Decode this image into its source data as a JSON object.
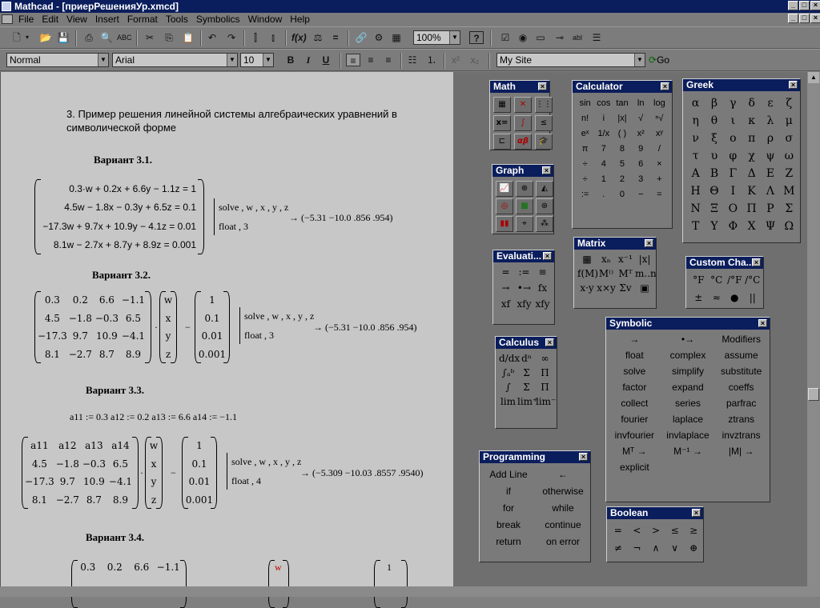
{
  "window": {
    "title": "Mathcad - [приерРешенияУр.xmcd]"
  },
  "menu": [
    "File",
    "Edit",
    "View",
    "Insert",
    "Format",
    "Tools",
    "Symbolics",
    "Window",
    "Help"
  ],
  "toolbar": {
    "zoom": "100%",
    "style": "Normal",
    "font": "Arial",
    "size": "10",
    "address": "My Site",
    "go": "Go"
  },
  "doc": {
    "heading": "3. Пример решения линейной системы алгебраических уравнений в символической форме",
    "v1": {
      "title": "Вариант 3.1.",
      "eqs": [
        "0.3·w + 0.2x + 6.6y − 1.1z = 1",
        "4.5w − 1.8x − 0.3y + 6.5z = 0.1",
        "−17.3w + 9.7x + 10.9y − 4.1z = 0.01",
        "8.1w − 2.7x + 8.7y + 8.9z = 0.001"
      ],
      "cmd1": "solve , w , x , y , z",
      "cmd2": "float , 3",
      "result": "→ (−5.31   −10.0   .856   .954)"
    },
    "v2": {
      "title": "Вариант 3.2.",
      "A": [
        [
          "0.3",
          "0.2",
          "6.6",
          "−1.1"
        ],
        [
          "4.5",
          "−1.8",
          "−0.3",
          "6.5"
        ],
        [
          "−17.3",
          "9.7",
          "10.9",
          "−4.1"
        ],
        [
          "8.1",
          "−2.7",
          "8.7",
          "8.9"
        ]
      ],
      "vars": [
        "w",
        "x",
        "y",
        "z"
      ],
      "b": [
        "1",
        "0.1",
        "0.01",
        "0.001"
      ],
      "cmd1": "solve , w , x , y , z",
      "cmd2": "float , 3",
      "result": "→ (−5.31   −10.0   .856   .954)"
    },
    "v3": {
      "title": "Вариант 3.3.",
      "defs": "a11 := 0.3    a12 := 0.2    a13 := 6.6    a14 := −1.1",
      "A": [
        [
          "a11",
          "a12",
          "a13",
          "a14"
        ],
        [
          "4.5",
          "−1.8",
          "−0.3",
          "6.5"
        ],
        [
          "−17.3",
          "9.7",
          "10.9",
          "−4.1"
        ],
        [
          "8.1",
          "−2.7",
          "8.7",
          "8.9"
        ]
      ],
      "vars": [
        "w",
        "x",
        "y",
        "z"
      ],
      "b": [
        "1",
        "0.1",
        "0.01",
        "0.001"
      ],
      "cmd1": "solve , w , x , y , z",
      "cmd2": "float , 4",
      "result": "→ (−5.309   −10.03   .8557   .9540)"
    },
    "v4": {
      "title": "Вариант 3.4.",
      "row": [
        "0.3",
        "0.2",
        "6.6",
        "−1.1"
      ],
      "var": "w",
      "b": "1"
    }
  },
  "palettes": {
    "math": {
      "title": "Math",
      "items": [
        "calculator-icon",
        "graph-icon",
        "matrix-icon",
        "evaluation-icon",
        "calculus-icon",
        "boolean-icon",
        "programming-icon",
        "greek-icon",
        "symbolic-icon"
      ]
    },
    "calculator": {
      "title": "Calculator",
      "rows": [
        [
          "sin",
          "cos",
          "tan",
          "ln",
          "log"
        ],
        [
          "n!",
          "i",
          "|x|",
          "√",
          "ⁿ√"
        ],
        [
          "eˣ",
          "1/x",
          "( )",
          "x²",
          "xʸ"
        ],
        [
          "π",
          "7",
          "8",
          "9",
          "/"
        ],
        [
          "÷",
          "4",
          "5",
          "6",
          "×"
        ],
        [
          "÷",
          "1",
          "2",
          "3",
          "+"
        ],
        [
          ":=",
          ".",
          "0",
          "−",
          "="
        ]
      ]
    },
    "greek": {
      "title": "Greek",
      "rows": [
        [
          "α",
          "β",
          "γ",
          "δ",
          "ε",
          "ζ"
        ],
        [
          "η",
          "θ",
          "ι",
          "κ",
          "λ",
          "μ"
        ],
        [
          "ν",
          "ξ",
          "ο",
          "π",
          "ρ",
          "σ"
        ],
        [
          "τ",
          "υ",
          "φ",
          "χ",
          "ψ",
          "ω"
        ],
        [
          "Α",
          "Β",
          "Γ",
          "Δ",
          "Ε",
          "Ζ"
        ],
        [
          "Η",
          "Θ",
          "Ι",
          "Κ",
          "Λ",
          "Μ"
        ],
        [
          "Ν",
          "Ξ",
          "Ο",
          "Π",
          "Ρ",
          "Σ"
        ],
        [
          "Τ",
          "Υ",
          "Φ",
          "Χ",
          "Ψ",
          "Ω"
        ]
      ]
    },
    "graph": {
      "title": "Graph"
    },
    "matrix": {
      "title": "Matrix"
    },
    "custom": {
      "title": "Custom Cha...",
      "rows": [
        [
          "°F",
          "°C",
          "/°F",
          "/°C"
        ],
        [
          "±",
          "≈",
          "●",
          "||"
        ]
      ]
    },
    "evaluation": {
      "title": "Evaluati...",
      "rows": [
        [
          "=",
          ":=",
          "≡"
        ],
        [
          "→",
          "•→",
          "fx"
        ],
        [
          "xf",
          "xfy",
          "xfy"
        ]
      ]
    },
    "symbolic": {
      "title": "Symbolic",
      "rows": [
        [
          "→",
          "•→",
          "Modifiers"
        ],
        [
          "float",
          "complex",
          "assume"
        ],
        [
          "solve",
          "simplify",
          "substitute"
        ],
        [
          "factor",
          "expand",
          "coeffs"
        ],
        [
          "collect",
          "series",
          "parfrac"
        ],
        [
          "fourier",
          "laplace",
          "ztrans"
        ],
        [
          "invfourier",
          "invlaplace",
          "invztrans"
        ],
        [
          "Mᵀ →",
          "M⁻¹ →",
          "|M| →"
        ],
        [
          "explicit",
          "",
          ""
        ]
      ]
    },
    "calculus": {
      "title": "Calculus"
    },
    "programming": {
      "title": "Programming",
      "rows": [
        [
          "Add Line",
          "←"
        ],
        [
          "if",
          "otherwise"
        ],
        [
          "for",
          "while"
        ],
        [
          "break",
          "continue"
        ],
        [
          "return",
          "on error"
        ]
      ]
    },
    "boolean": {
      "title": "Boolean",
      "rows": [
        [
          "=",
          "<",
          ">",
          "≤",
          "≥"
        ],
        [
          "≠",
          "¬",
          "∧",
          "∨",
          "⊕"
        ]
      ]
    }
  }
}
